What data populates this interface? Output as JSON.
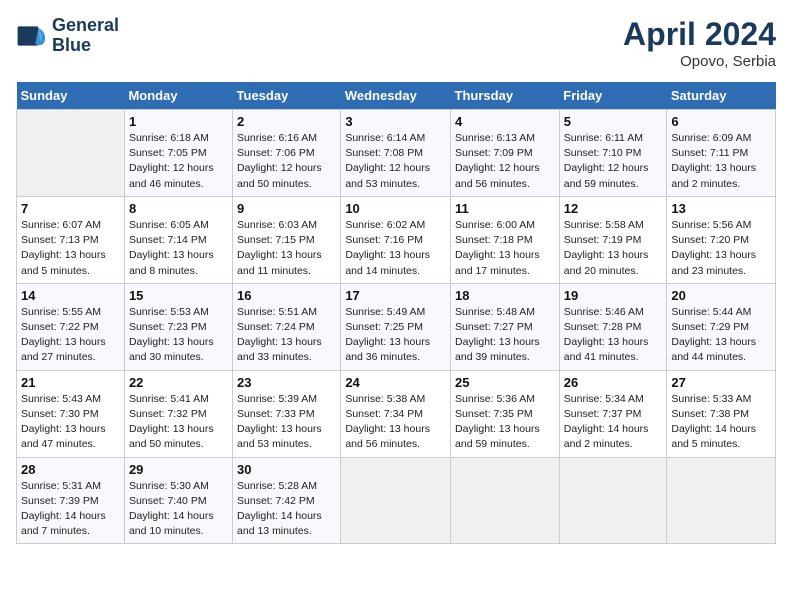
{
  "header": {
    "logo_line1": "General",
    "logo_line2": "Blue",
    "title": "April 2024",
    "subtitle": "Opovo, Serbia"
  },
  "weekdays": [
    "Sunday",
    "Monday",
    "Tuesday",
    "Wednesday",
    "Thursday",
    "Friday",
    "Saturday"
  ],
  "weeks": [
    [
      {
        "day": "",
        "info": ""
      },
      {
        "day": "1",
        "info": "Sunrise: 6:18 AM\nSunset: 7:05 PM\nDaylight: 12 hours\nand 46 minutes."
      },
      {
        "day": "2",
        "info": "Sunrise: 6:16 AM\nSunset: 7:06 PM\nDaylight: 12 hours\nand 50 minutes."
      },
      {
        "day": "3",
        "info": "Sunrise: 6:14 AM\nSunset: 7:08 PM\nDaylight: 12 hours\nand 53 minutes."
      },
      {
        "day": "4",
        "info": "Sunrise: 6:13 AM\nSunset: 7:09 PM\nDaylight: 12 hours\nand 56 minutes."
      },
      {
        "day": "5",
        "info": "Sunrise: 6:11 AM\nSunset: 7:10 PM\nDaylight: 12 hours\nand 59 minutes."
      },
      {
        "day": "6",
        "info": "Sunrise: 6:09 AM\nSunset: 7:11 PM\nDaylight: 13 hours\nand 2 minutes."
      }
    ],
    [
      {
        "day": "7",
        "info": "Sunrise: 6:07 AM\nSunset: 7:13 PM\nDaylight: 13 hours\nand 5 minutes."
      },
      {
        "day": "8",
        "info": "Sunrise: 6:05 AM\nSunset: 7:14 PM\nDaylight: 13 hours\nand 8 minutes."
      },
      {
        "day": "9",
        "info": "Sunrise: 6:03 AM\nSunset: 7:15 PM\nDaylight: 13 hours\nand 11 minutes."
      },
      {
        "day": "10",
        "info": "Sunrise: 6:02 AM\nSunset: 7:16 PM\nDaylight: 13 hours\nand 14 minutes."
      },
      {
        "day": "11",
        "info": "Sunrise: 6:00 AM\nSunset: 7:18 PM\nDaylight: 13 hours\nand 17 minutes."
      },
      {
        "day": "12",
        "info": "Sunrise: 5:58 AM\nSunset: 7:19 PM\nDaylight: 13 hours\nand 20 minutes."
      },
      {
        "day": "13",
        "info": "Sunrise: 5:56 AM\nSunset: 7:20 PM\nDaylight: 13 hours\nand 23 minutes."
      }
    ],
    [
      {
        "day": "14",
        "info": "Sunrise: 5:55 AM\nSunset: 7:22 PM\nDaylight: 13 hours\nand 27 minutes."
      },
      {
        "day": "15",
        "info": "Sunrise: 5:53 AM\nSunset: 7:23 PM\nDaylight: 13 hours\nand 30 minutes."
      },
      {
        "day": "16",
        "info": "Sunrise: 5:51 AM\nSunset: 7:24 PM\nDaylight: 13 hours\nand 33 minutes."
      },
      {
        "day": "17",
        "info": "Sunrise: 5:49 AM\nSunset: 7:25 PM\nDaylight: 13 hours\nand 36 minutes."
      },
      {
        "day": "18",
        "info": "Sunrise: 5:48 AM\nSunset: 7:27 PM\nDaylight: 13 hours\nand 39 minutes."
      },
      {
        "day": "19",
        "info": "Sunrise: 5:46 AM\nSunset: 7:28 PM\nDaylight: 13 hours\nand 41 minutes."
      },
      {
        "day": "20",
        "info": "Sunrise: 5:44 AM\nSunset: 7:29 PM\nDaylight: 13 hours\nand 44 minutes."
      }
    ],
    [
      {
        "day": "21",
        "info": "Sunrise: 5:43 AM\nSunset: 7:30 PM\nDaylight: 13 hours\nand 47 minutes."
      },
      {
        "day": "22",
        "info": "Sunrise: 5:41 AM\nSunset: 7:32 PM\nDaylight: 13 hours\nand 50 minutes."
      },
      {
        "day": "23",
        "info": "Sunrise: 5:39 AM\nSunset: 7:33 PM\nDaylight: 13 hours\nand 53 minutes."
      },
      {
        "day": "24",
        "info": "Sunrise: 5:38 AM\nSunset: 7:34 PM\nDaylight: 13 hours\nand 56 minutes."
      },
      {
        "day": "25",
        "info": "Sunrise: 5:36 AM\nSunset: 7:35 PM\nDaylight: 13 hours\nand 59 minutes."
      },
      {
        "day": "26",
        "info": "Sunrise: 5:34 AM\nSunset: 7:37 PM\nDaylight: 14 hours\nand 2 minutes."
      },
      {
        "day": "27",
        "info": "Sunrise: 5:33 AM\nSunset: 7:38 PM\nDaylight: 14 hours\nand 5 minutes."
      }
    ],
    [
      {
        "day": "28",
        "info": "Sunrise: 5:31 AM\nSunset: 7:39 PM\nDaylight: 14 hours\nand 7 minutes."
      },
      {
        "day": "29",
        "info": "Sunrise: 5:30 AM\nSunset: 7:40 PM\nDaylight: 14 hours\nand 10 minutes."
      },
      {
        "day": "30",
        "info": "Sunrise: 5:28 AM\nSunset: 7:42 PM\nDaylight: 14 hours\nand 13 minutes."
      },
      {
        "day": "",
        "info": ""
      },
      {
        "day": "",
        "info": ""
      },
      {
        "day": "",
        "info": ""
      },
      {
        "day": "",
        "info": ""
      }
    ]
  ]
}
